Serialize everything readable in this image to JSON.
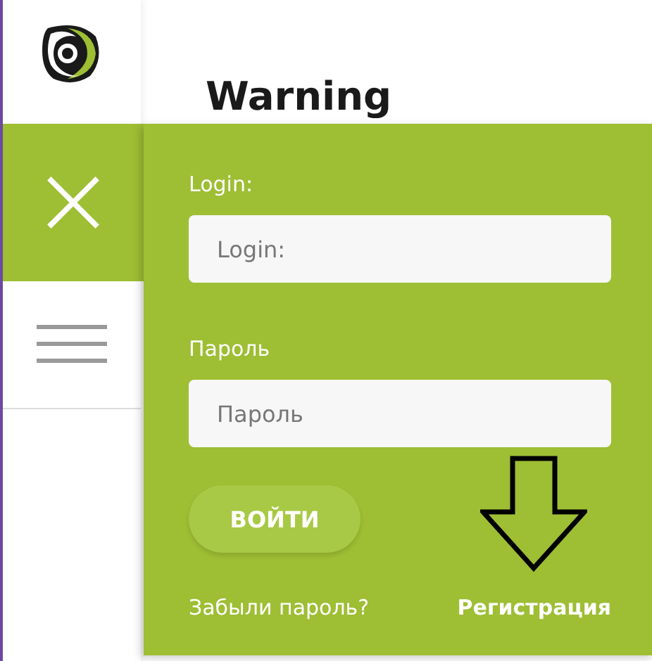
{
  "heading": "Warning",
  "login_form": {
    "login_label": "Login:",
    "login_placeholder": "Login:",
    "password_label": "Пароль",
    "password_placeholder": "Пароль",
    "submit": "ВОЙТИ",
    "forgot_link": "Забыли пароль?",
    "register_link": "Регистрация"
  }
}
